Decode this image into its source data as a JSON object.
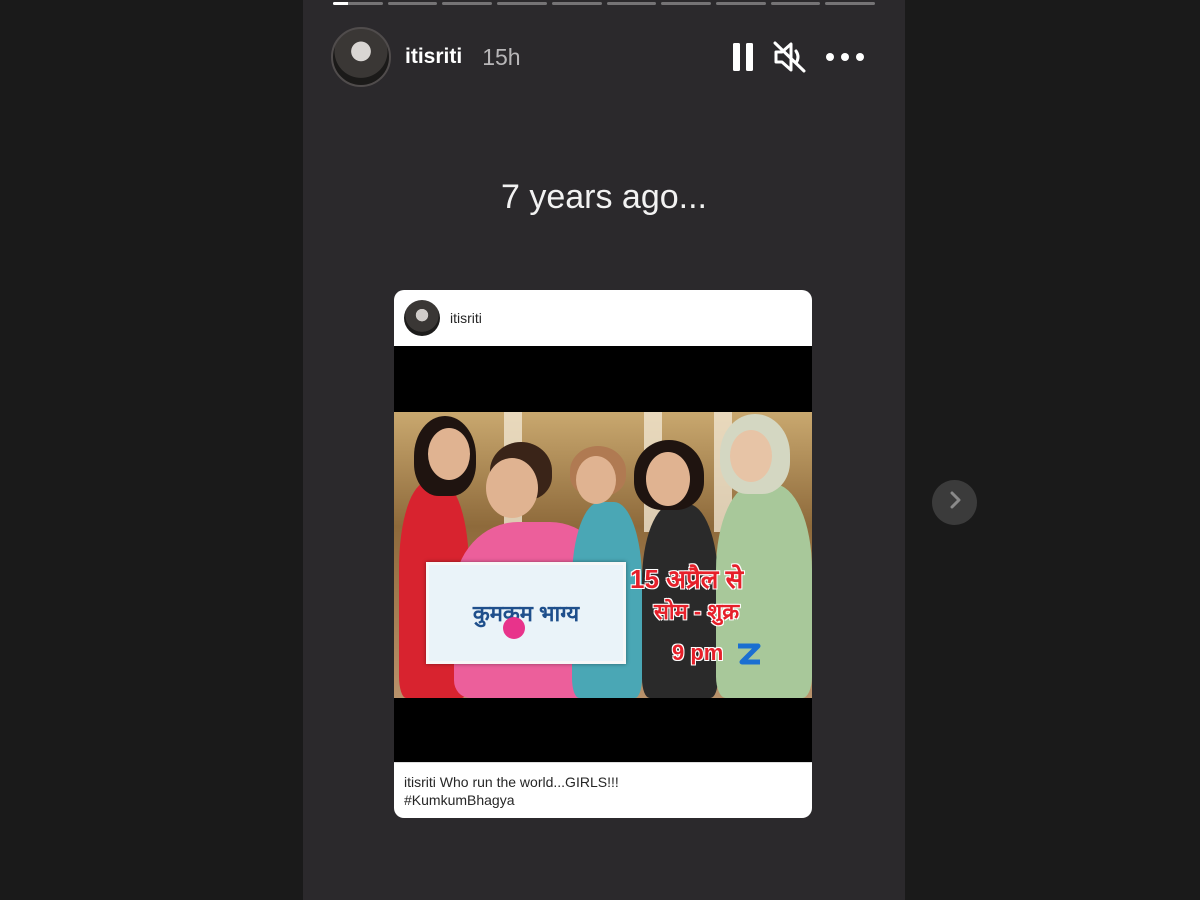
{
  "story": {
    "progress": {
      "segments": 10,
      "current": 0,
      "current_fill": 0.3
    },
    "user": {
      "username": "itisriti",
      "time": "15h"
    },
    "controls": {
      "pause_icon": "pause-icon",
      "mute_icon": "muted-speaker-icon",
      "more_icon": "more-options-icon"
    },
    "caption": "7 years ago..."
  },
  "shared_post": {
    "username": "itisriti",
    "poster": {
      "logo_text": "कुमकुम भाग्य",
      "promo_line1": "15 अप्रैल से",
      "promo_line2": "सोम - शुक्र",
      "promo_time": "9 pm",
      "channel": "ZEE TV"
    },
    "caption_user": "itisriti",
    "caption_text": "Who run the world...GIRLS!!!",
    "hashtag": "#KumkumBhagya"
  },
  "navigation": {
    "next_icon": "chevron-right-icon"
  },
  "colors": {
    "background": "#1a1a1a",
    "story_bg": "#2b292c",
    "accent_red": "#e6202a"
  }
}
